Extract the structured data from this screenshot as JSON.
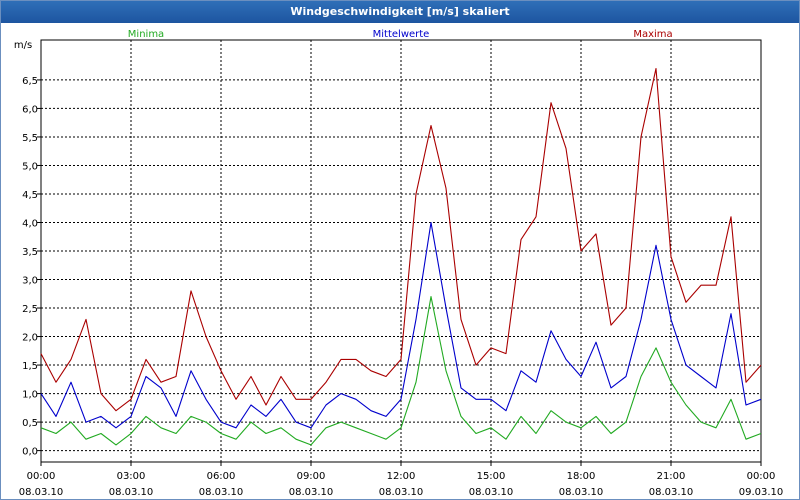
{
  "window": {
    "title": "Windgeschwindigkeit [m/s] skaliert"
  },
  "colors": {
    "minima": "#22aa22",
    "mittelwerte": "#0000cc",
    "maxima": "#aa0000",
    "grid": "#000000"
  },
  "chart_data": {
    "type": "line",
    "ylabel": "m/s",
    "ylim": [
      -0.2,
      7.2
    ],
    "yticks": [
      "0,0",
      "0,5",
      "1,0",
      "1,5",
      "2,0",
      "2,5",
      "3,0",
      "3,5",
      "4,0",
      "4,5",
      "5,0",
      "5,5",
      "6,0",
      "6,5"
    ],
    "xticks": [
      {
        "time": "00:00",
        "date": "08.03.10"
      },
      {
        "time": "03:00",
        "date": "08.03.10"
      },
      {
        "time": "06:00",
        "date": "08.03.10"
      },
      {
        "time": "09:00",
        "date": "08.03.10"
      },
      {
        "time": "12:00",
        "date": "08.03.10"
      },
      {
        "time": "15:00",
        "date": "08.03.10"
      },
      {
        "time": "18:00",
        "date": "08.03.10"
      },
      {
        "time": "21:00",
        "date": "08.03.10"
      },
      {
        "time": "00:00",
        "date": "09.03.10"
      }
    ],
    "x_hours": [
      0,
      0.5,
      1,
      1.5,
      2,
      2.5,
      3,
      3.5,
      4,
      4.5,
      5,
      5.5,
      6,
      6.5,
      7,
      7.5,
      8,
      8.5,
      9,
      9.5,
      10,
      10.5,
      11,
      11.5,
      12,
      12.5,
      13,
      13.5,
      14,
      14.5,
      15,
      15.5,
      16,
      16.5,
      17,
      17.5,
      18,
      18.5,
      19,
      19.5,
      20,
      20.5,
      21,
      21.5,
      22,
      22.5,
      23,
      23.5,
      24
    ],
    "series": [
      {
        "name": "Minima",
        "values": [
          0.4,
          0.3,
          0.5,
          0.2,
          0.3,
          0.1,
          0.3,
          0.6,
          0.4,
          0.3,
          0.6,
          0.5,
          0.3,
          0.2,
          0.5,
          0.3,
          0.4,
          0.2,
          0.1,
          0.4,
          0.5,
          0.4,
          0.3,
          0.2,
          0.4,
          1.2,
          2.7,
          1.4,
          0.6,
          0.3,
          0.4,
          0.2,
          0.6,
          0.3,
          0.7,
          0.5,
          0.4,
          0.6,
          0.3,
          0.5,
          1.3,
          1.8,
          1.2,
          0.8,
          0.5,
          0.4,
          0.9,
          0.2,
          0.3
        ]
      },
      {
        "name": "Mittelwerte",
        "values": [
          1.0,
          0.6,
          1.2,
          0.5,
          0.6,
          0.4,
          0.6,
          1.3,
          1.1,
          0.6,
          1.4,
          0.9,
          0.5,
          0.4,
          0.8,
          0.6,
          0.9,
          0.5,
          0.4,
          0.8,
          1.0,
          0.9,
          0.7,
          0.6,
          0.9,
          2.3,
          4.0,
          2.5,
          1.1,
          0.9,
          0.9,
          0.7,
          1.4,
          1.2,
          2.1,
          1.6,
          1.3,
          1.9,
          1.1,
          1.3,
          2.3,
          3.6,
          2.3,
          1.5,
          1.3,
          1.1,
          2.4,
          0.8,
          0.9
        ]
      },
      {
        "name": "Maxima",
        "values": [
          1.7,
          1.2,
          1.6,
          2.3,
          1.0,
          0.7,
          0.9,
          1.6,
          1.2,
          1.3,
          2.8,
          2.0,
          1.4,
          0.9,
          1.3,
          0.8,
          1.3,
          0.9,
          0.9,
          1.2,
          1.6,
          1.6,
          1.4,
          1.3,
          1.6,
          4.5,
          5.7,
          4.6,
          2.3,
          1.5,
          1.8,
          1.7,
          3.7,
          4.1,
          6.1,
          5.3,
          3.5,
          3.8,
          2.2,
          2.5,
          5.5,
          6.7,
          3.4,
          2.6,
          2.9,
          2.9,
          4.1,
          1.2,
          1.5
        ]
      }
    ]
  }
}
